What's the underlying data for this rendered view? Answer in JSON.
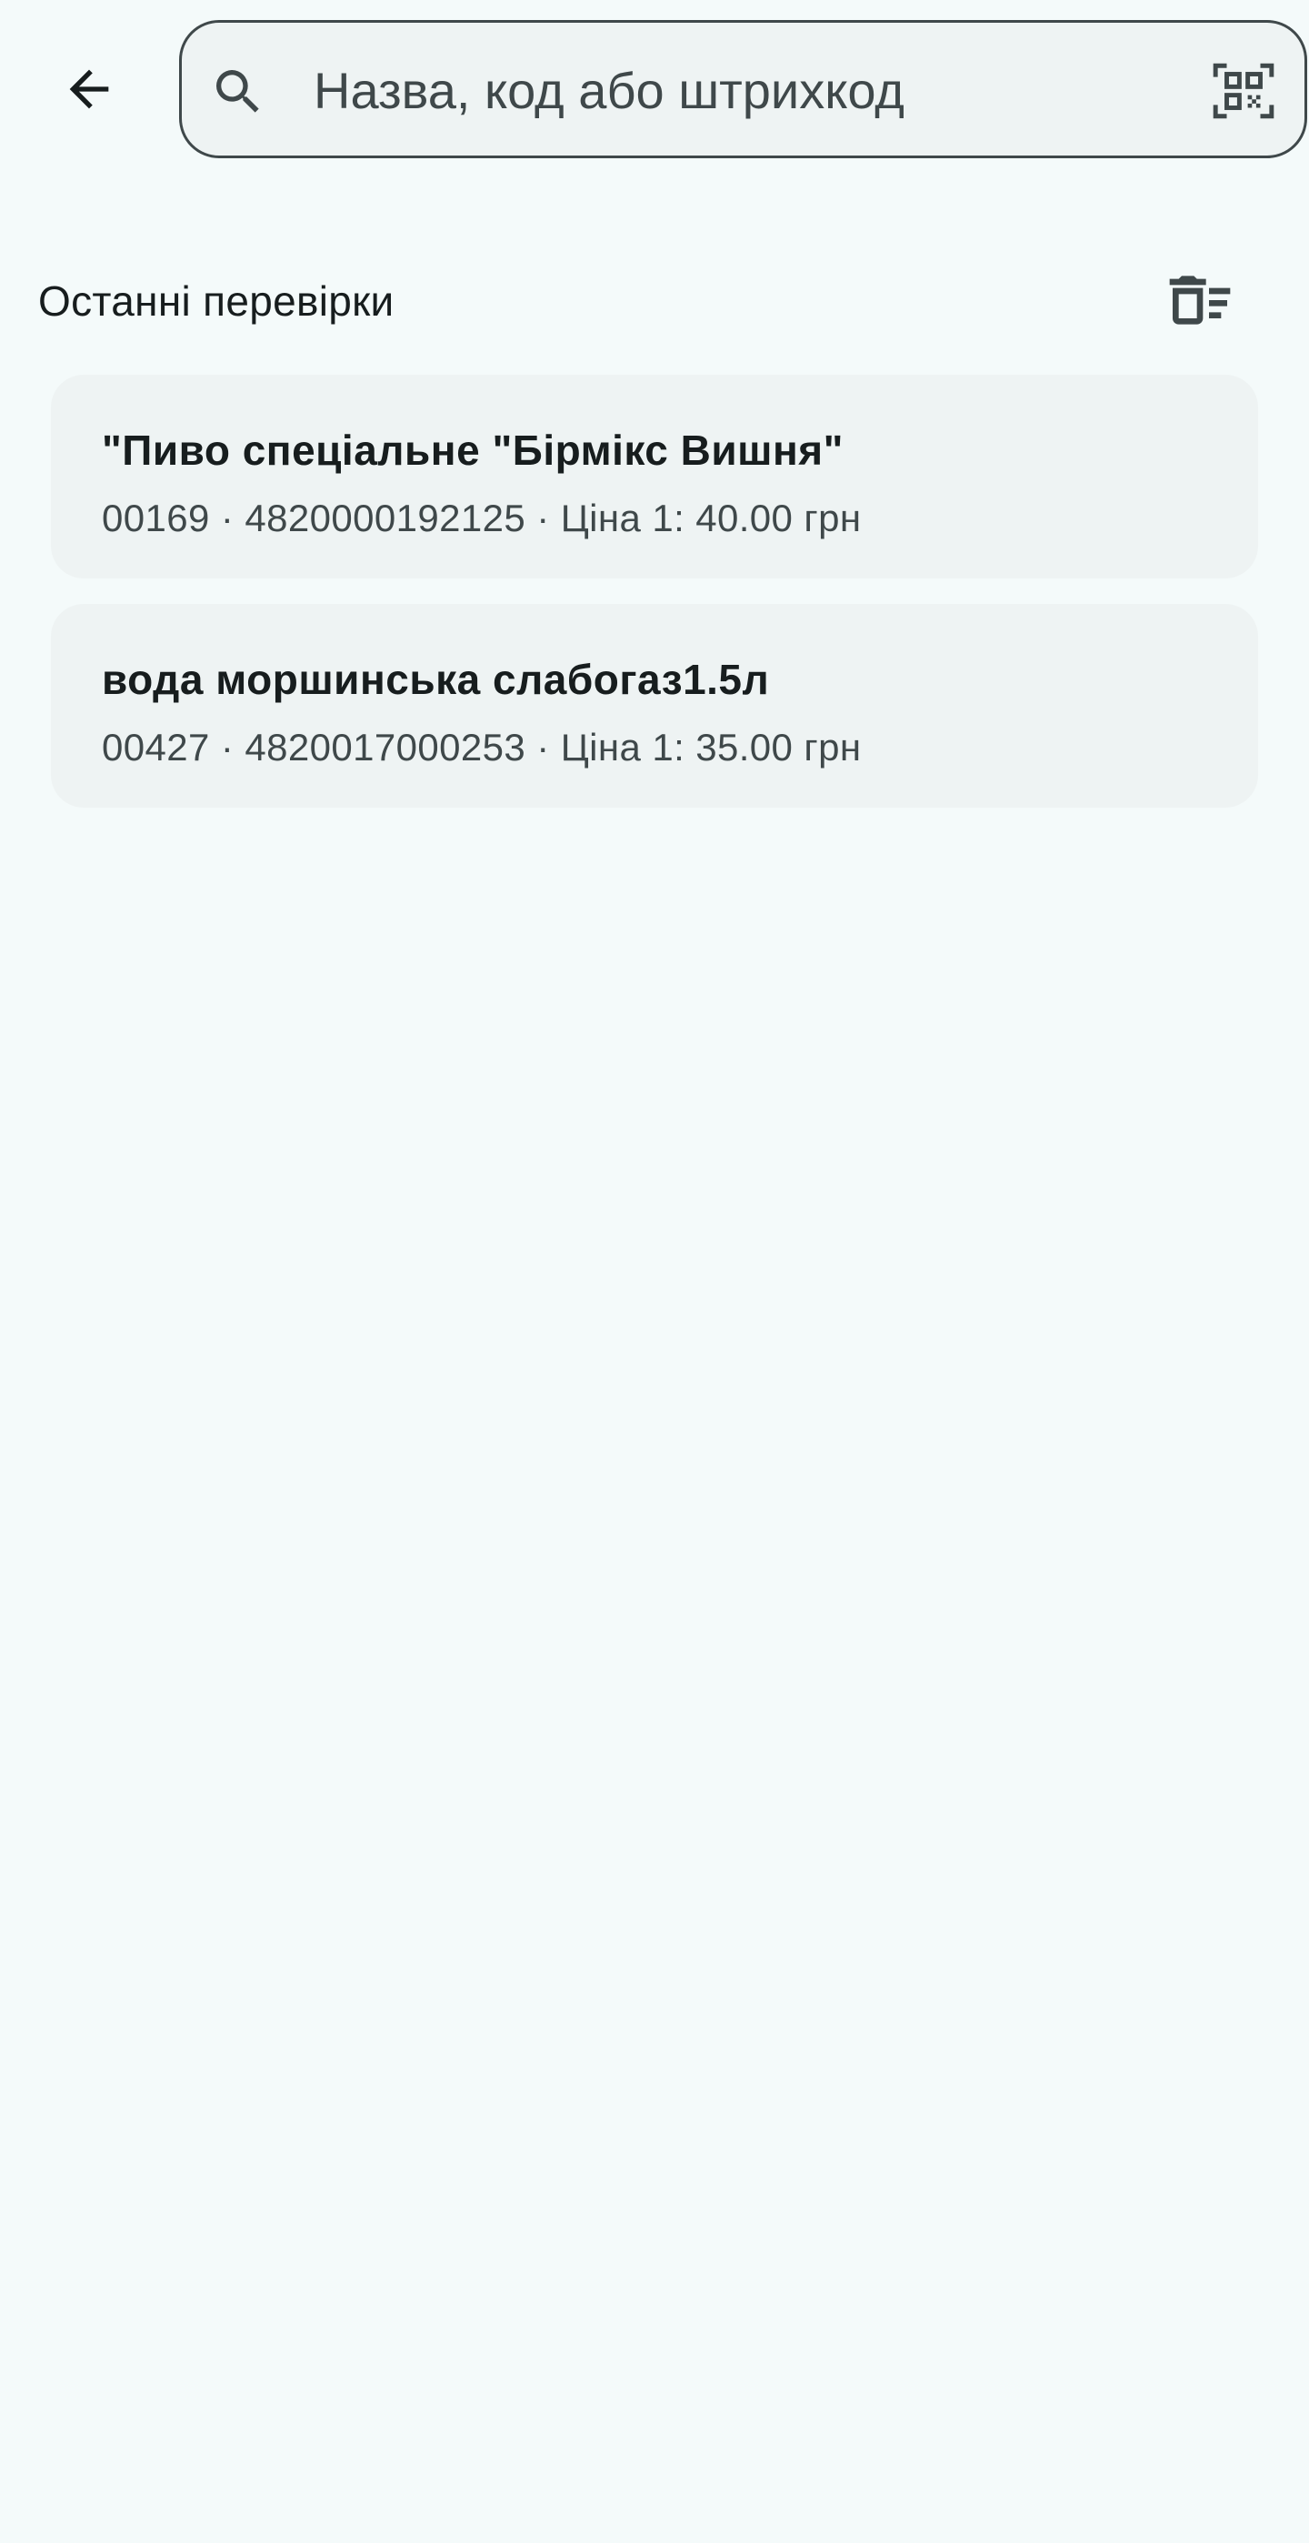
{
  "top_bar": {
    "back_icon": "arrow-back-icon",
    "search": {
      "placeholder": "Назва, код або штрихкод",
      "value": "",
      "search_icon": "search-icon",
      "scan_icon": "qr-code-scanner-icon"
    }
  },
  "history": {
    "title": "Останні перевірки",
    "clear_icon": "delete-sweep-icon",
    "items": [
      {
        "name": "\"Пиво спеціальне \"Бірмікс Вишня\"",
        "details": "00169 · 4820000192125 · Ціна 1: 40.00 грн"
      },
      {
        "name": "вода моршинська слабогаз1.5л",
        "details": "00427 · 4820017000253 · Ціна 1: 35.00 грн"
      }
    ]
  },
  "colors": {
    "background": "#f4fafa",
    "card_background": "#eef3f3",
    "text_primary": "#171d1e",
    "text_secondary": "#3f484a",
    "outline": "#3f484a"
  }
}
